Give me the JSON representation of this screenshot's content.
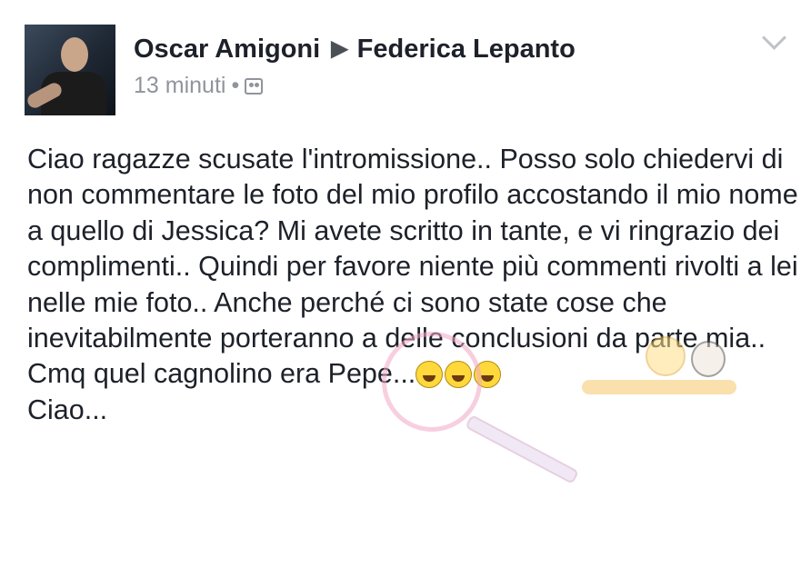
{
  "post": {
    "author": "Oscar Amigoni",
    "recipient": "Federica Lepanto",
    "arrow_glyph": "▶",
    "timestamp": "13 minuti",
    "separator": "•",
    "audience_icon": "friends-icon",
    "menu_icon": "chevron-down-icon",
    "avatar_icon": "profile-photo",
    "paragraphs": [
      "Ciao ragazze scusate l'intromissione.. Posso solo chiedervi di non commentare le foto del mio profilo accostando il mio nome a quello di Jessica? Mi avete scritto in tante, e vi ringrazio dei complimenti.. Quindi per favore niente più commenti rivolti a lei nelle mie foto.. Anche perché ci sono state cose che inevitabilmente porteranno a delle conclusioni da parte mia..",
      "Cmq quel cagnolino era Pepe...",
      "Ciao..."
    ],
    "emoji_names": [
      "laughing-tears-emoji",
      "laughing-tears-emoji",
      "laughing-tears-emoji"
    ]
  }
}
